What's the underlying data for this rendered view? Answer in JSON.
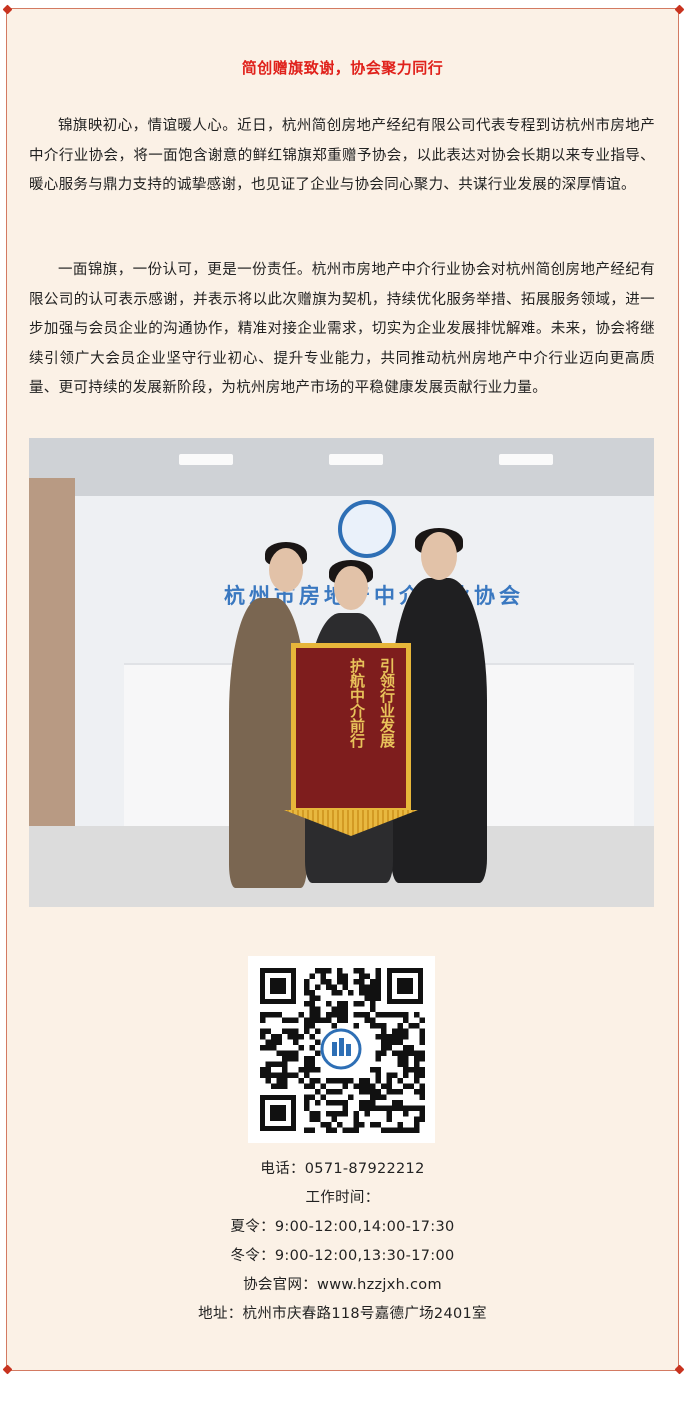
{
  "article": {
    "title": "简创赠旗致谢，协会聚力同行",
    "paragraphs": [
      "锦旗映初心，情谊暖人心。近日，杭州简创房地产经纪有限公司代表专程到访杭州市房地产中介行业协会，将一面饱含谢意的鲜红锦旗郑重赠予协会，以此表达对协会长期以来专业指导、暖心服务与鼎力支持的诚挚感谢，也见证了企业与协会同心聚力、共谋行业发展的深厚情谊。",
      "一面锦旗，一份认可，更是一份责任。杭州市房地产中介行业协会对杭州简创房地产经纪有限公司的认可表示感谢，并表示将以此次赠旗为契机，持续优化服务举措、拓展服务领域，进一步加强与会员企业的沟通协作，精准对接企业需求，切实为企业发展排忧解难。未来，协会将继续引领广大会员企业坚守行业初心、提升专业能力，共同推动杭州房地产中介行业迈向更高质量、更可持续的发展新阶段，为杭州房地产市场的平稳健康发展贡献行业力量。"
    ]
  },
  "photo": {
    "wall_sign": "杭州市房地产中介行业协会",
    "banner_line1": "引领行业发展",
    "banner_line2": "护航中介前行"
  },
  "contact": {
    "phone": "电话：0571-87922212",
    "hours_label": "工作时间：",
    "summer": "夏令：9:00-12:00,14:00-17:30",
    "winter": "冬令：9:00-12:00,13:30-17:00",
    "website": "协会官网：www.hzzjxh.com",
    "address": "地址：杭州市庆春路118号嘉德广场2401室"
  },
  "colors": {
    "title": "#e0211b",
    "frame_border": "#d37a62",
    "frame_bg": "#fbf1e6"
  }
}
